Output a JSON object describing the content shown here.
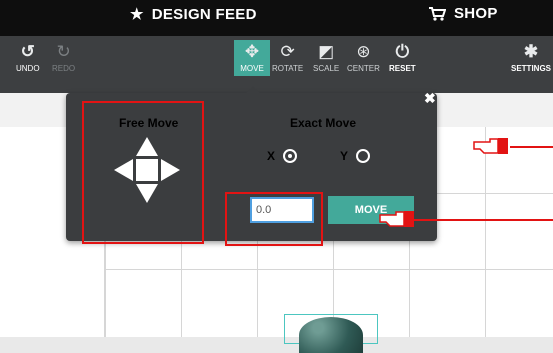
{
  "topbar": {
    "design_feed": "DESIGN FEED",
    "shop": "SHOP"
  },
  "toolbar": {
    "undo": "UNDO",
    "redo": "REDO",
    "move": "MOVE",
    "rotate": "ROTATE",
    "scale": "SCALE",
    "center": "CENTER",
    "reset": "RESET",
    "settings": "SETTINGS"
  },
  "panel": {
    "free_move": "Free Move",
    "exact_move": "Exact Move",
    "axis_x": "X",
    "axis_y": "Y",
    "selected_axis": "X",
    "input_value": "0.0",
    "move_button": "MOVE",
    "close": "✖"
  },
  "colors": {
    "accent": "#43a99a",
    "annotation": "#e21313",
    "toolbar_bg": "#3d3f41",
    "topbar_bg": "#0e0e0e"
  }
}
